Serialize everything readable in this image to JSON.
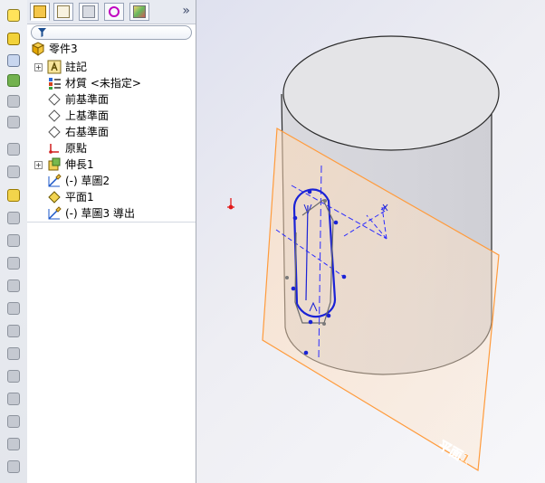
{
  "left_toolbar": {
    "icons": [
      "new-part-icon",
      "box-icon",
      "scale-icon",
      "extrude-icon",
      "revolve-icon",
      "loft-icon",
      "shell-icon",
      "draft-icon",
      "mirror-icon",
      "fillet-icon",
      "pattern-icon",
      "sweep-icon",
      "boundary-icon",
      "rib-icon",
      "wrap-icon",
      "dome-icon",
      "cut-icon",
      "move-icon",
      "cylinder-icon",
      "plane-icon",
      "sheet-icon"
    ]
  },
  "panel": {
    "tabs": [
      "feature-manager-icon",
      "property-manager-icon",
      "configuration-manager-icon",
      "dimxpert-icon",
      "display-manager-icon"
    ],
    "more_glyph": "»",
    "filter_icon": "filter-icon",
    "tree": {
      "root_label": "零件3",
      "items": [
        {
          "label": "註記",
          "icon": "annotation-icon",
          "expandable": true
        },
        {
          "label": "材質 <未指定>",
          "icon": "material-icon",
          "expandable": false
        },
        {
          "label": "前基準面",
          "icon": "plane-icon",
          "expandable": false
        },
        {
          "label": "上基準面",
          "icon": "plane-icon",
          "expandable": false
        },
        {
          "label": "右基準面",
          "icon": "plane-icon",
          "expandable": false
        },
        {
          "label": "原點",
          "icon": "origin-icon",
          "expandable": false
        },
        {
          "label": "伸長1",
          "icon": "extrude-icon",
          "expandable": true
        },
        {
          "label": "(-) 草圖2",
          "icon": "sketch-icon",
          "expandable": false
        },
        {
          "label": "平面1",
          "icon": "plane-yellow-icon",
          "expandable": false
        },
        {
          "label": "(-) 草圖3 導出",
          "icon": "sketch-icon",
          "expandable": false
        }
      ]
    },
    "splitter_glyph": "‹"
  },
  "viewport": {
    "plane_label": "平面1",
    "colors": {
      "cylinder_fill": "#d7d7db",
      "cylinder_side": "#c9c8cf",
      "cylinder_top": "#e3e3e6",
      "sketch_blue": "#1e2ed8",
      "plane_orange": "#ff9b3c",
      "axis_red": "#e21a1a"
    }
  }
}
